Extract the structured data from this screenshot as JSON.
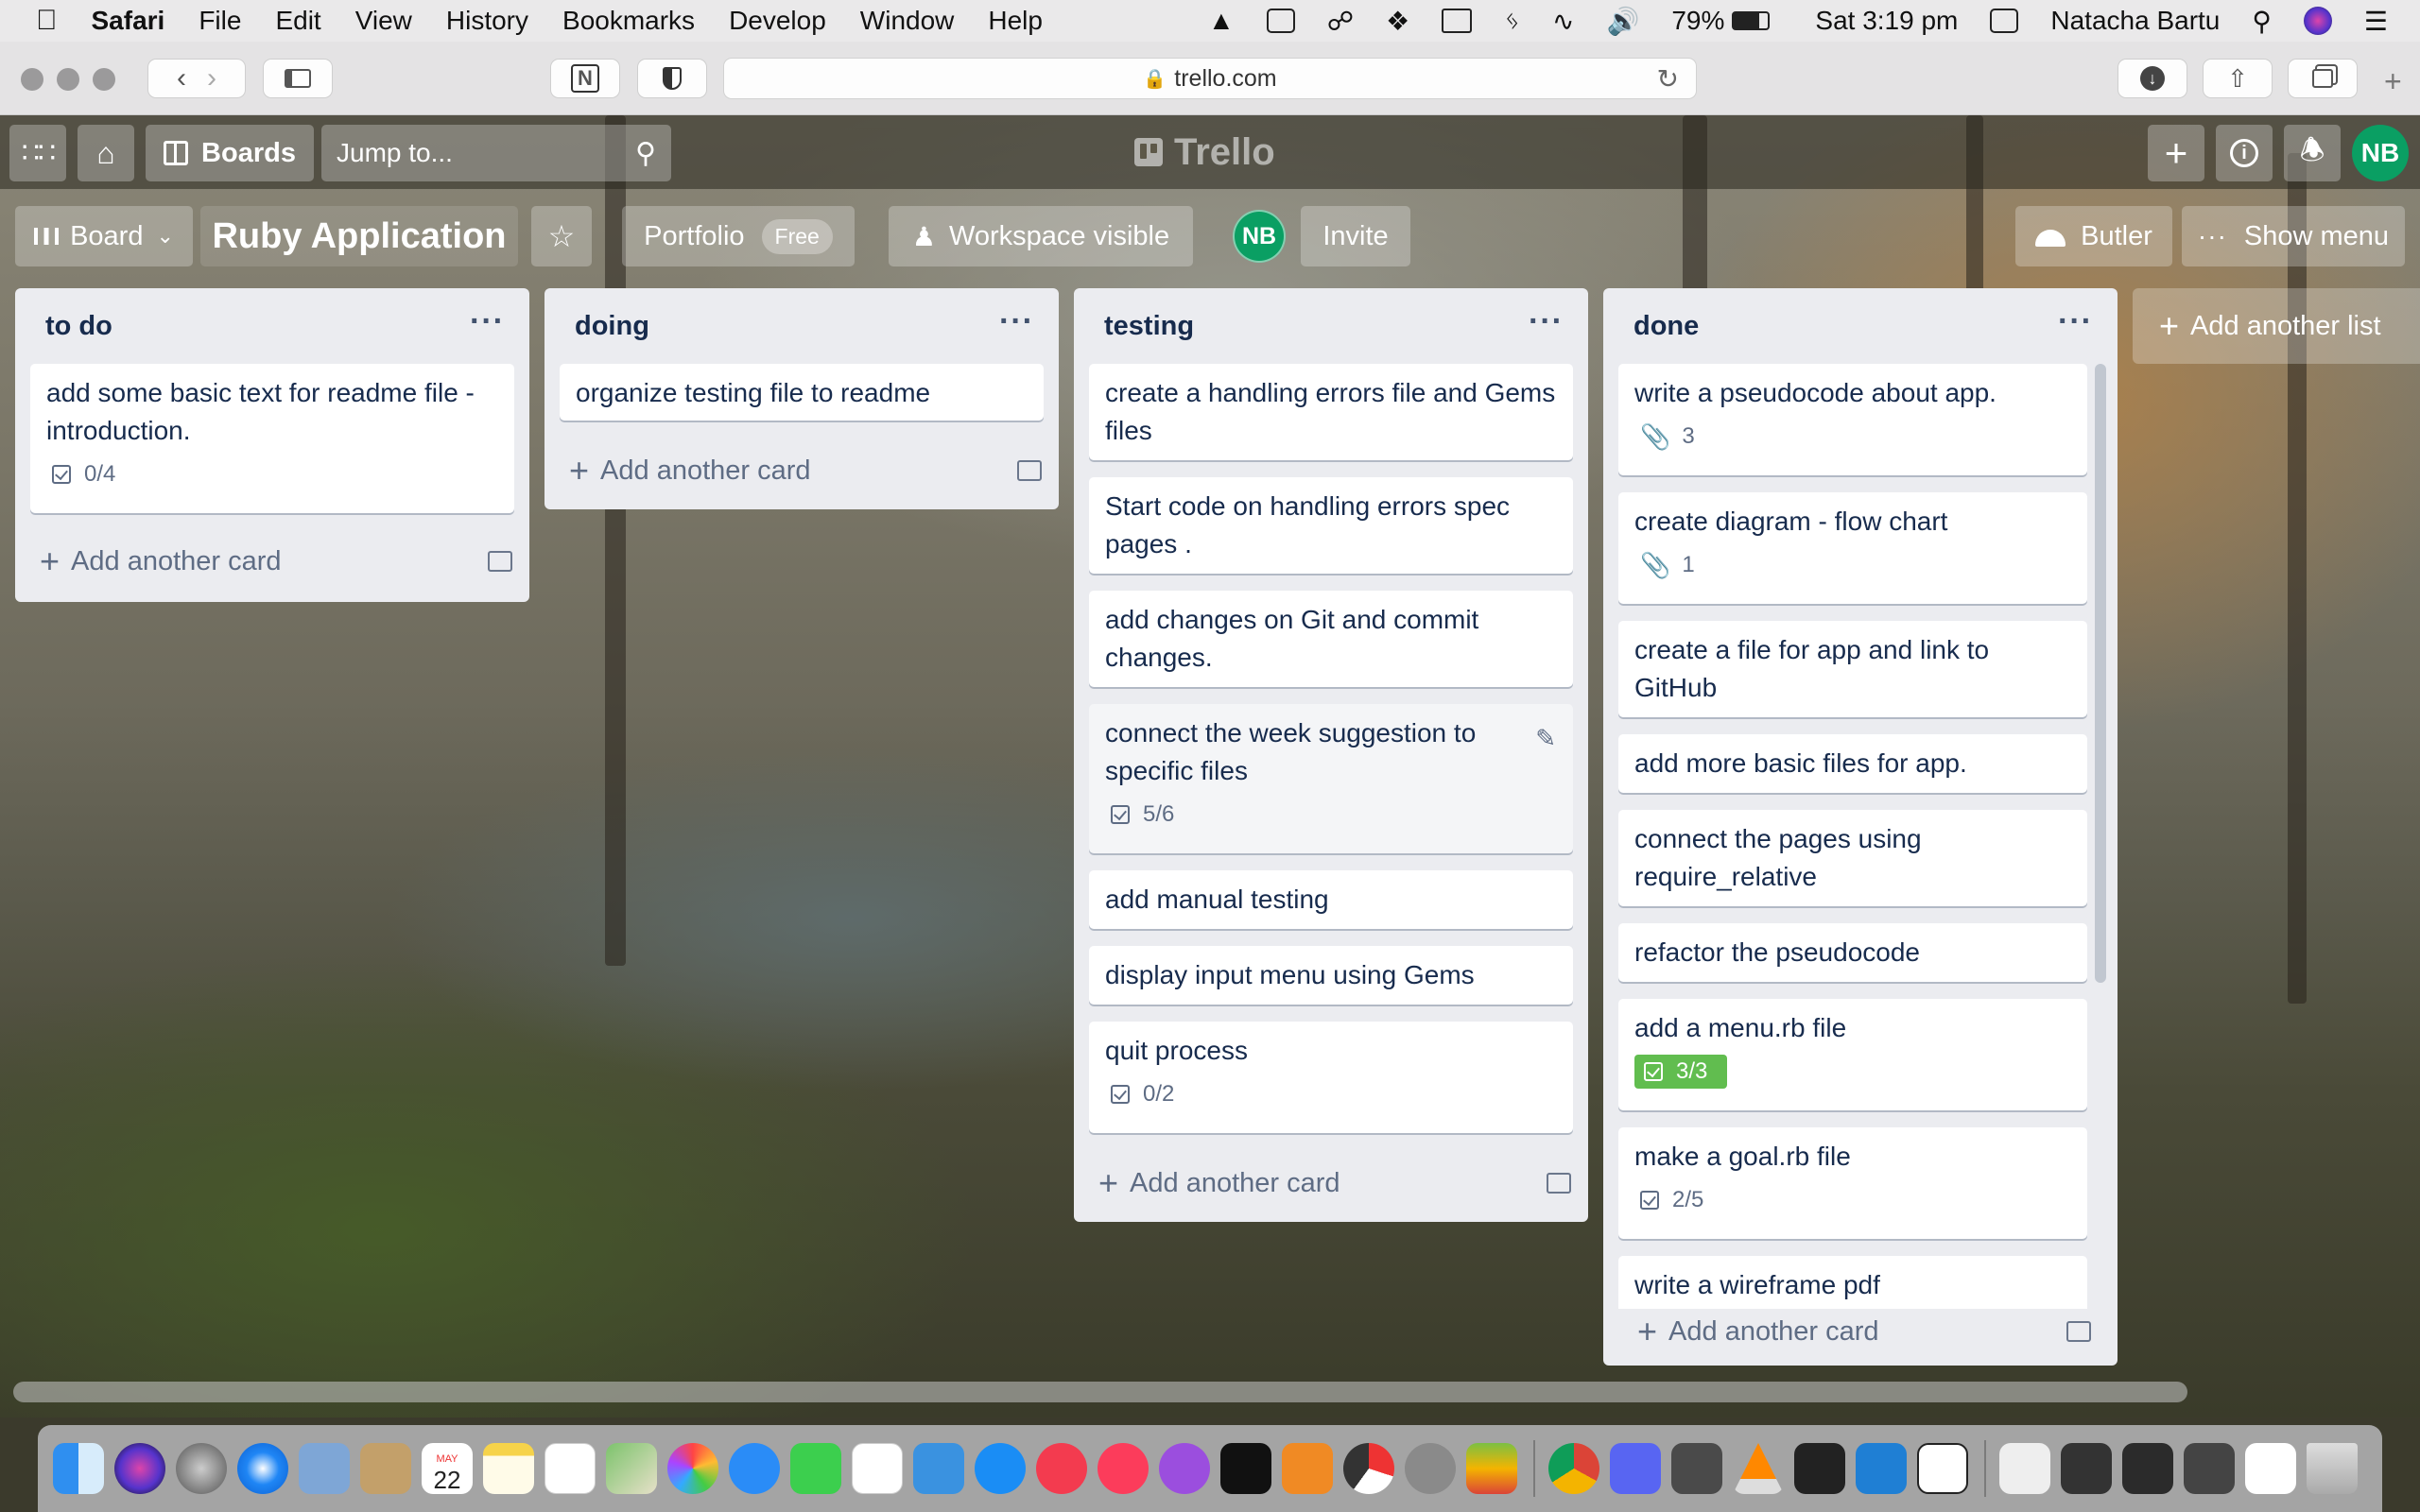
{
  "menubar": {
    "app": "Safari",
    "items": [
      "File",
      "Edit",
      "View",
      "History",
      "Bookmarks",
      "Develop",
      "Window",
      "Help"
    ],
    "battery": "79%",
    "clock": "Sat 3:19 pm",
    "user": "Natacha Bartu"
  },
  "browser": {
    "url": "trello.com",
    "back_icon": "chevron-left-icon",
    "forward_icon": "chevron-right-icon"
  },
  "trello_header": {
    "boards_label": "Boards",
    "jump_placeholder": "Jump to...",
    "logo": "Trello",
    "avatar_initials": "NB"
  },
  "board_header": {
    "view_label": "Board",
    "title": "Ruby Application",
    "portfolio_label": "Portfolio",
    "portfolio_badge": "Free",
    "visibility_label": "Workspace visible",
    "member_initials": "NB",
    "invite_label": "Invite",
    "butler_label": "Butler",
    "menu_label": "Show menu"
  },
  "lists": [
    {
      "name": "to do",
      "add_label": "Add another card",
      "cards": [
        {
          "title": "add some basic text for readme file - introduction.",
          "checklist": "0/4"
        }
      ]
    },
    {
      "name": "doing",
      "add_label": "Add another card",
      "cards": [
        {
          "title": "organize testing file to readme"
        }
      ]
    },
    {
      "name": "testing",
      "add_label": "Add another card",
      "cards": [
        {
          "title": "create a handling errors file and Gems files"
        },
        {
          "title": "Start code on handling errors spec pages ."
        },
        {
          "title": "add changes on Git and commit changes."
        },
        {
          "title": "connect the week suggestion to specific files",
          "checklist": "5/6"
        },
        {
          "title": "add manual testing"
        },
        {
          "title": "display input menu using Gems"
        },
        {
          "title": "quit process",
          "checklist": "0/2"
        }
      ]
    },
    {
      "name": "done",
      "add_label": "Add another card",
      "cards": [
        {
          "title": "write a pseudocode about app.",
          "attachments": "3"
        },
        {
          "title": "create diagram - flow chart",
          "attachments": "1"
        },
        {
          "title": "create a file for app and link to GitHub"
        },
        {
          "title": "add more basic files for app."
        },
        {
          "title": "connect the pages using require_relative"
        },
        {
          "title": "refactor the pseudocode"
        },
        {
          "title": "add a menu.rb file",
          "checklist": "3/3",
          "checklist_complete": true
        },
        {
          "title": "make a goal.rb file",
          "checklist": "2/5"
        },
        {
          "title": "write a wireframe pdf"
        }
      ]
    }
  ],
  "add_list_label": "Add another list",
  "dock": {
    "calendar_day": "22",
    "calendar_month": "MAY"
  },
  "colors": {
    "list_bg": "#ebecf0",
    "avatar": "#0a9f63",
    "checklist_done": "#61bd4f",
    "text": "#172b4d"
  }
}
